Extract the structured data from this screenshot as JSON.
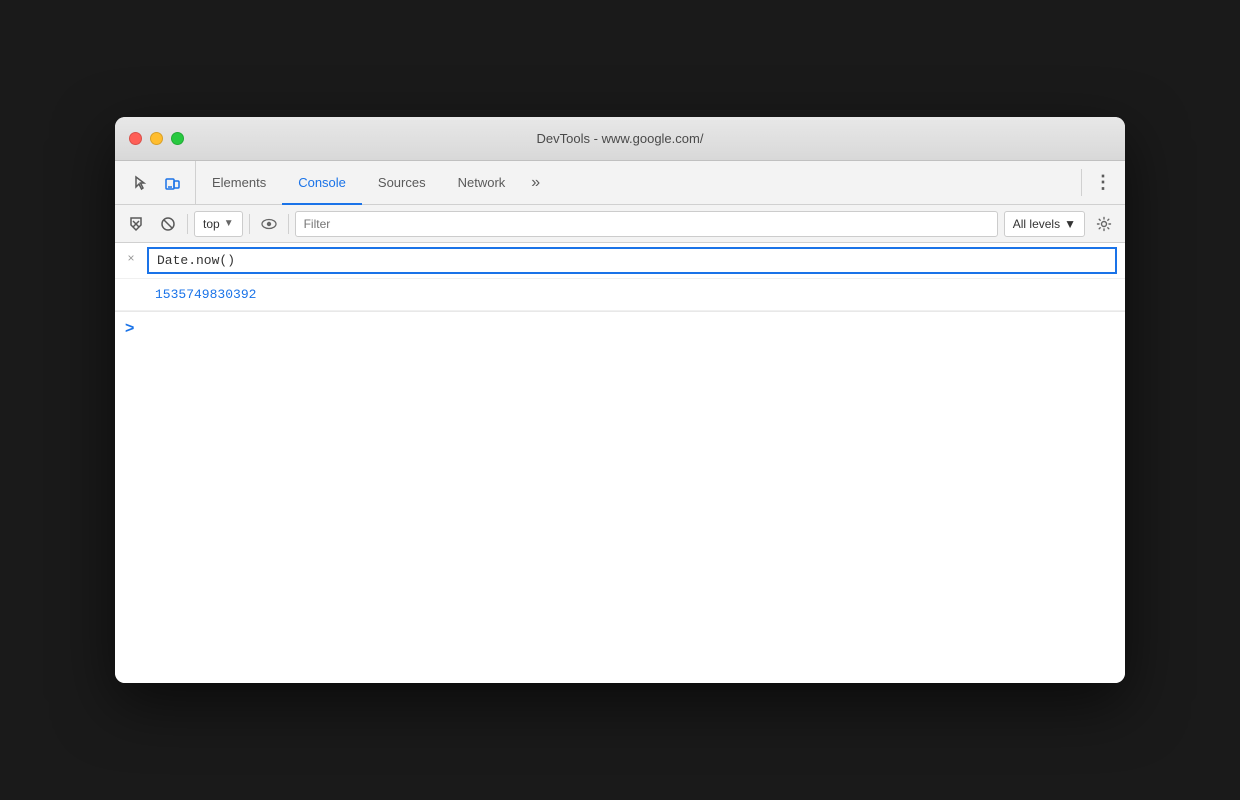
{
  "titleBar": {
    "title": "DevTools - www.google.com/"
  },
  "tabs": {
    "items": [
      {
        "id": "elements",
        "label": "Elements",
        "active": false
      },
      {
        "id": "console",
        "label": "Console",
        "active": true
      },
      {
        "id": "sources",
        "label": "Sources",
        "active": false
      },
      {
        "id": "network",
        "label": "Network",
        "active": false
      }
    ],
    "more_label": "»",
    "menu_label": "⋮"
  },
  "consoleToolbar": {
    "context_value": "top",
    "context_arrow": "▼",
    "filter_placeholder": "Filter",
    "levels_label": "All levels",
    "levels_arrow": "▼"
  },
  "consoleHistory": {
    "entry": {
      "input_value": "Date.now()",
      "result_value": "1535749830392",
      "close_icon": "×"
    }
  },
  "prompt": {
    "chevron": ">"
  },
  "colors": {
    "active_tab": "#1a73e8",
    "result_value": "#1a73e8"
  }
}
